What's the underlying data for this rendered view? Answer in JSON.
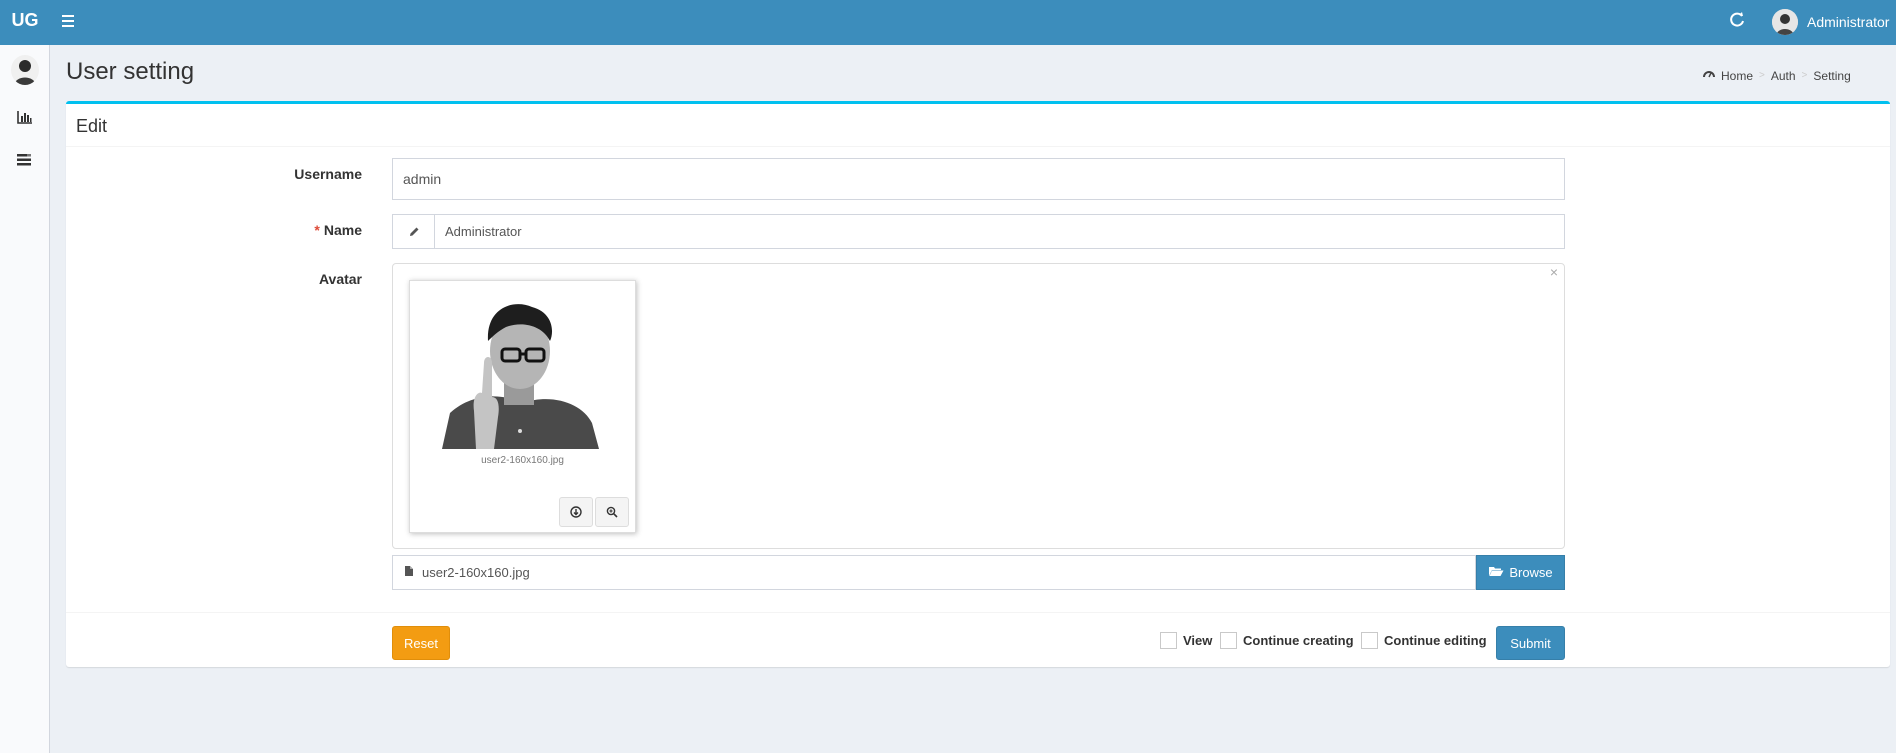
{
  "header": {
    "logo": "UG",
    "user_name": "Administrator"
  },
  "page": {
    "title": "User setting",
    "breadcrumb": [
      "Home",
      "Auth",
      "Setting"
    ]
  },
  "form": {
    "box_title": "Edit",
    "username": {
      "label": "Username",
      "value": "admin"
    },
    "name": {
      "required_mark": "*",
      "label": "Name",
      "value": "Administrator"
    },
    "avatar": {
      "label": "Avatar",
      "preview_caption": "user2-160x160.jpg",
      "file_name": "user2-160x160.jpg",
      "browse_label": "Browse"
    },
    "footer": {
      "reset_label": "Reset",
      "check_view": "View",
      "check_continue_creating": "Continue creating",
      "check_continue_editing": "Continue editing",
      "submit_label": "Submit"
    }
  },
  "colors": {
    "header": "#3c8dbc",
    "box_border": "#00c0ef",
    "reset": "#f39c12",
    "primary": "#3c8dbc"
  },
  "icons": [
    "bars-icon",
    "refresh-icon",
    "dashboard-icon",
    "bar-chart-icon",
    "list-icon",
    "pencil-icon",
    "file-icon",
    "folder-open-icon",
    "download-icon",
    "zoom-in-icon",
    "close-icon"
  ]
}
